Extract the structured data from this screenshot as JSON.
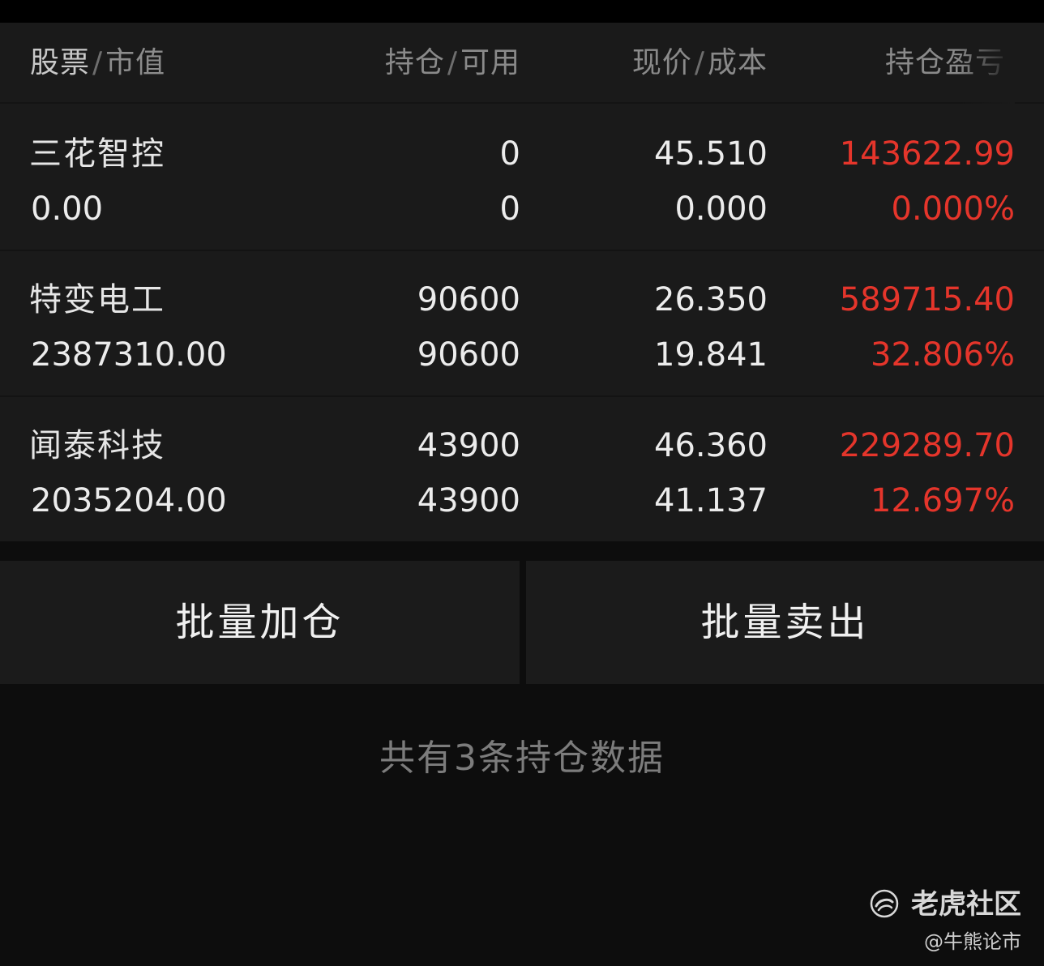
{
  "header": {
    "stock": "股票",
    "market_value": "市值",
    "position": "持仓",
    "available": "可用",
    "price": "现价",
    "cost": "成本",
    "pnl": "持仓盈亏",
    "separator": "/"
  },
  "holdings": [
    {
      "name": "三花智控",
      "market_value": "0.00",
      "position": "0",
      "available": "0",
      "price": "45.510",
      "cost": "0.000",
      "pnl": "143622.99",
      "pnl_pct": "0.000%"
    },
    {
      "name": "特变电工",
      "market_value": "2387310.00",
      "position": "90600",
      "available": "90600",
      "price": "26.350",
      "cost": "19.841",
      "pnl": "589715.40",
      "pnl_pct": "32.806%"
    },
    {
      "name": "闻泰科技",
      "market_value": "2035204.00",
      "position": "43900",
      "available": "43900",
      "price": "46.360",
      "cost": "41.137",
      "pnl": "229289.70",
      "pnl_pct": "12.697%"
    }
  ],
  "buttons": {
    "batch_add": "批量加仓",
    "batch_sell": "批量卖出"
  },
  "summary": "共有3条持仓数据",
  "watermark": {
    "brand": "老虎社区",
    "handle": "@牛熊论市"
  },
  "colors": {
    "background": "#0d0d0d",
    "panel": "#1a1a1a",
    "profit_red": "#e5352b",
    "text": "#ececec",
    "muted": "#7c7c7c"
  },
  "icons": {
    "brand_logo": "tiger-community-logo-icon"
  }
}
